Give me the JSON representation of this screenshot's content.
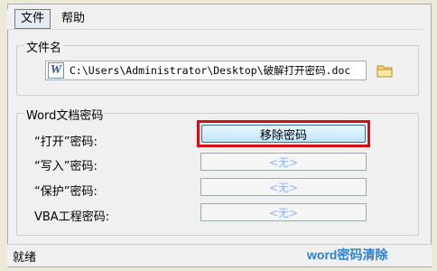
{
  "menu": {
    "file": "文件",
    "help": "帮助"
  },
  "file_group": {
    "title": "文件名",
    "path": "C:\\Users\\Administrator\\Desktop\\破解打开密码.doc",
    "file_icon_glyph": "W"
  },
  "password_group": {
    "title": "Word文档密码",
    "rows": [
      {
        "label": "“打开”密码:",
        "value": "移除密码"
      },
      {
        "label": "“写入”密码:",
        "value": "<无>"
      },
      {
        "label": "“保护”密码:",
        "value": "<无>"
      },
      {
        "label": "VBA工程密码:",
        "value": "<无>"
      }
    ]
  },
  "status": {
    "text": "就绪"
  },
  "watermark": "word密码清除",
  "colors": {
    "accent_red": "#d20f12",
    "field_text": "#8fb0ff",
    "watermark_blue": "#2f7fd2"
  }
}
